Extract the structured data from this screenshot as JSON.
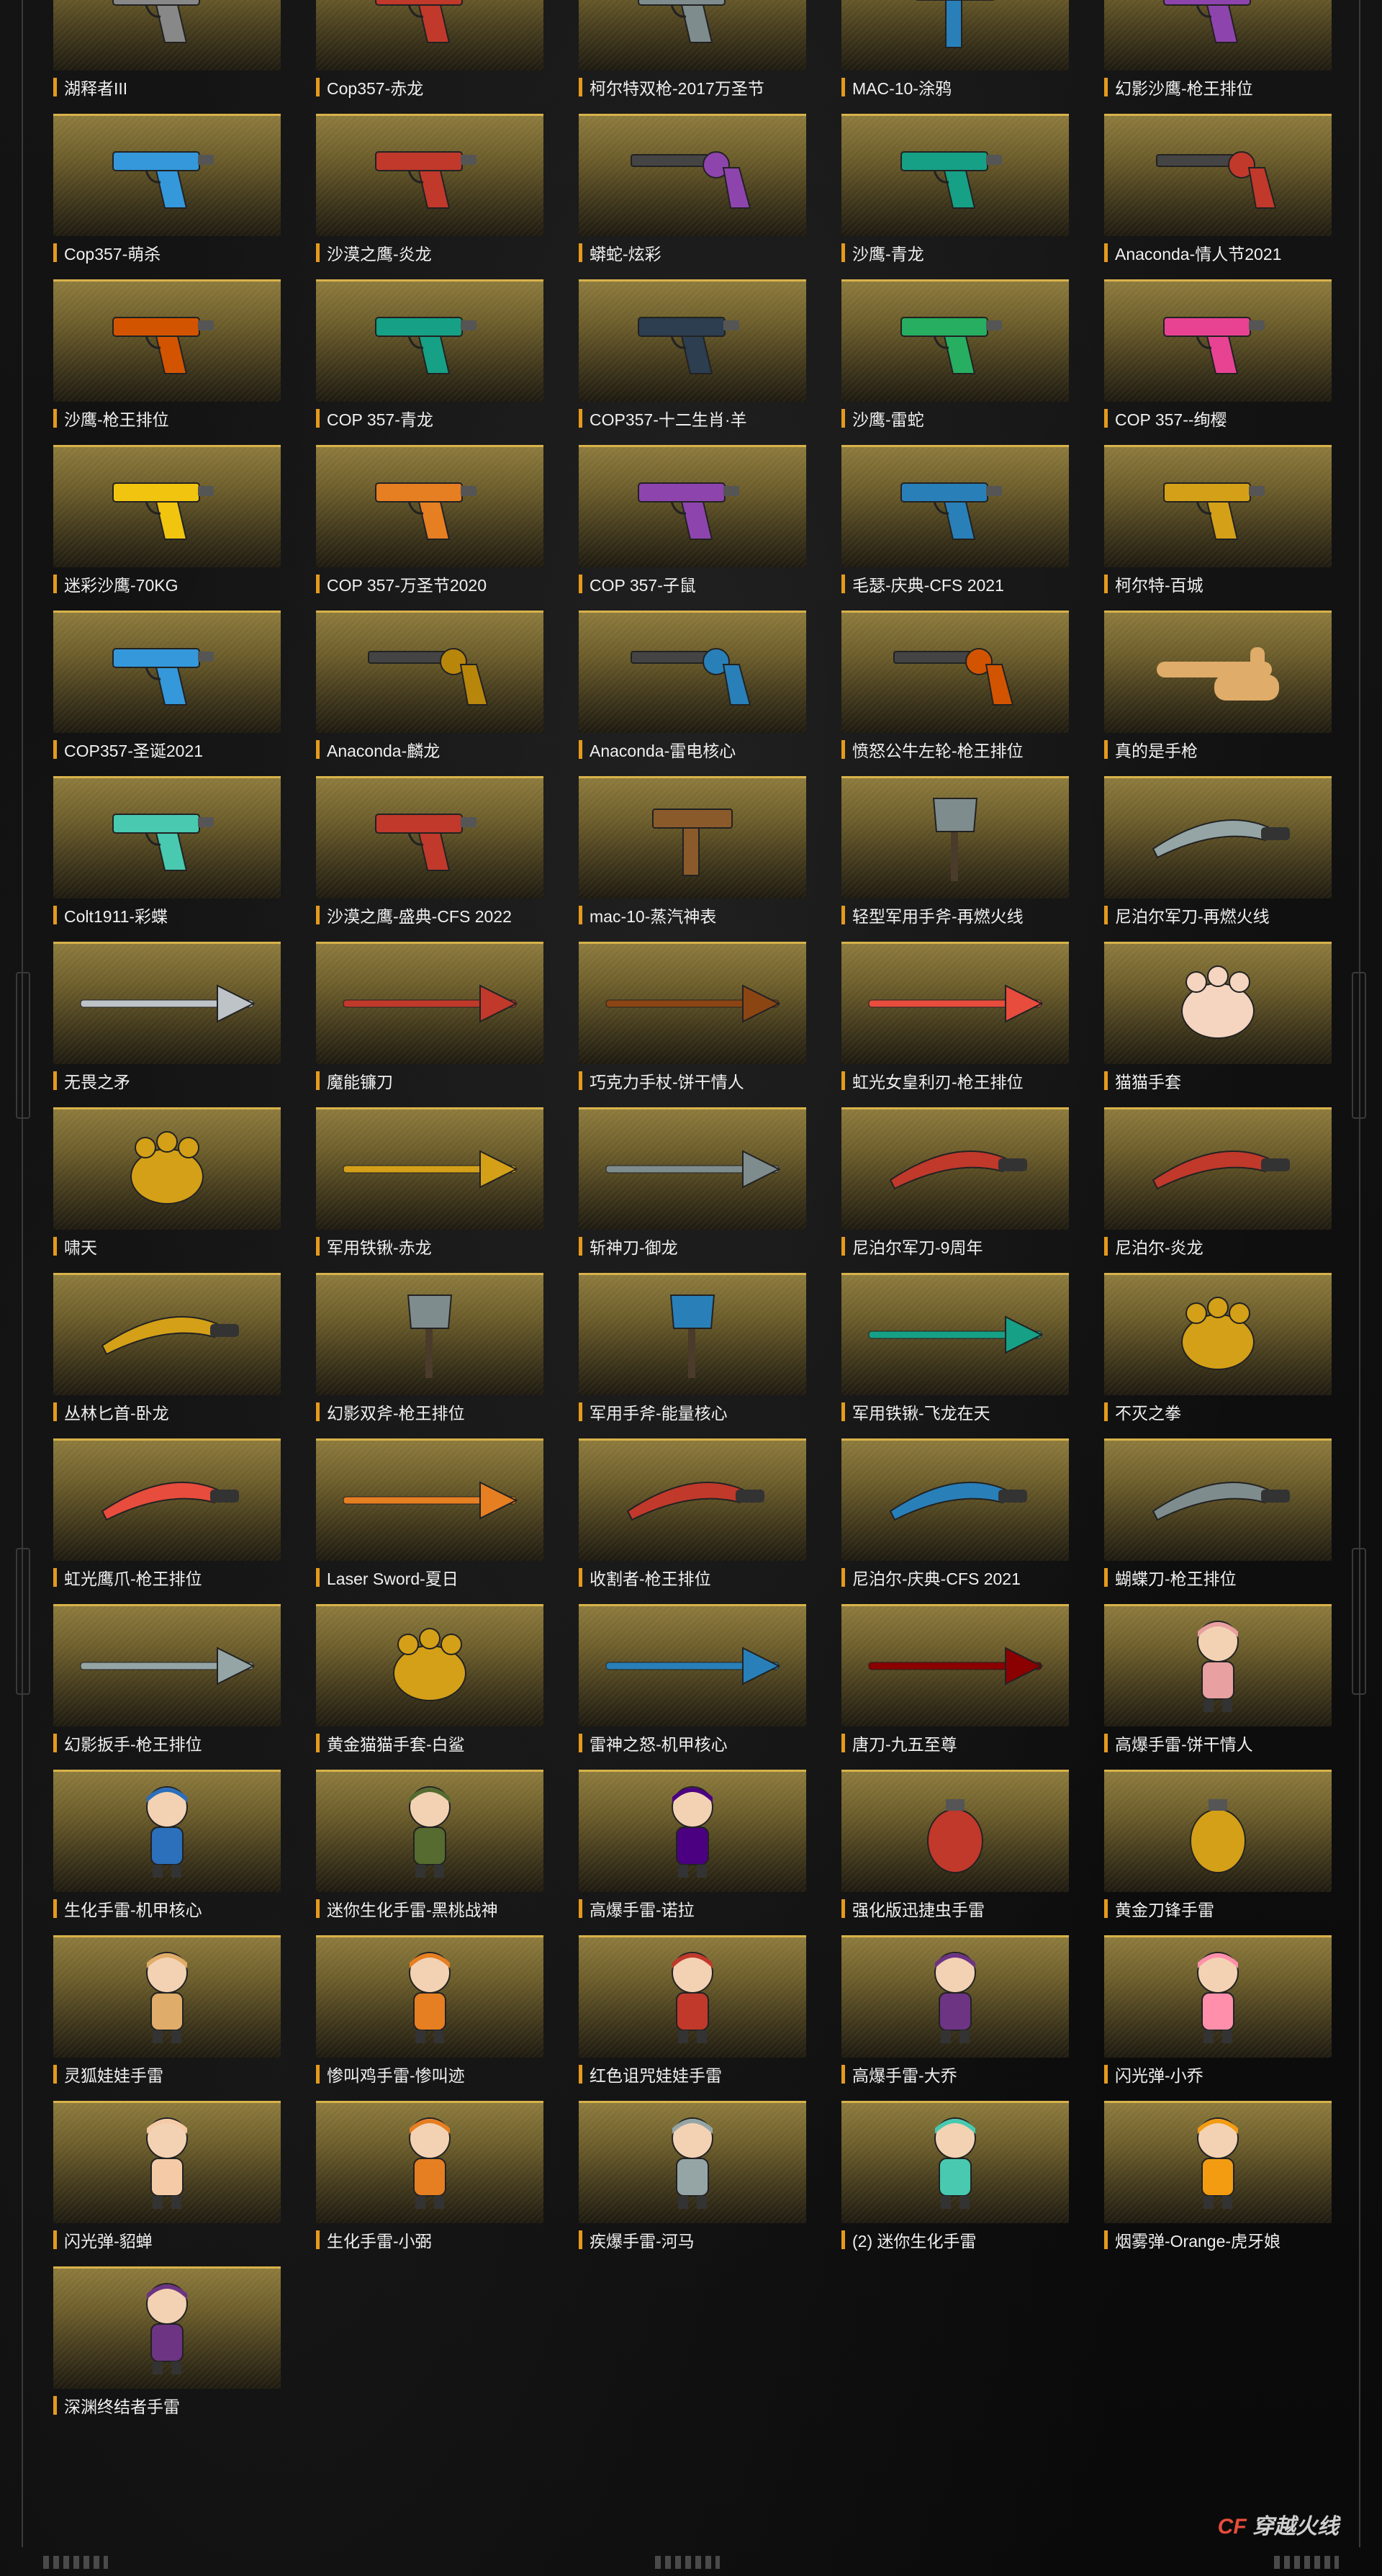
{
  "items": [
    {
      "label": "湖释者III",
      "icon": "gun-icon",
      "color": "#888888"
    },
    {
      "label": "Cop357-赤龙",
      "icon": "pistol-icon",
      "color": "#c0392b"
    },
    {
      "label": "柯尔特双枪-2017万圣节",
      "icon": "pistol-icon",
      "color": "#7f8c8d"
    },
    {
      "label": "MAC-10-涂鸦",
      "icon": "smg-icon",
      "color": "#2980b9"
    },
    {
      "label": "幻影沙鹰-枪王排位",
      "icon": "pistol-icon",
      "color": "#8e44ad"
    },
    {
      "label": "Cop357-萌杀",
      "icon": "pistol-icon",
      "color": "#3498db"
    },
    {
      "label": "沙漠之鹰-炎龙",
      "icon": "pistol-icon",
      "color": "#c0392b"
    },
    {
      "label": "蟒蛇-炫彩",
      "icon": "revolver-icon",
      "color": "#8e44ad"
    },
    {
      "label": "沙鹰-青龙",
      "icon": "pistol-icon",
      "color": "#16a085"
    },
    {
      "label": "Anaconda-情人节2021",
      "icon": "revolver-icon",
      "color": "#c0392b"
    },
    {
      "label": "沙鹰-枪王排位",
      "icon": "pistol-icon",
      "color": "#d35400"
    },
    {
      "label": "COP 357-青龙",
      "icon": "pistol-icon",
      "color": "#16a085"
    },
    {
      "label": "COP357-十二生肖·羊",
      "icon": "pistol-icon",
      "color": "#2c3e50"
    },
    {
      "label": "沙鹰-雷蛇",
      "icon": "pistol-icon",
      "color": "#27ae60"
    },
    {
      "label": "COP 357--绚樱",
      "icon": "pistol-icon",
      "color": "#e84393"
    },
    {
      "label": "迷彩沙鹰-70KG",
      "icon": "pistol-icon",
      "color": "#f1c40f"
    },
    {
      "label": "COP 357-万圣节2020",
      "icon": "pistol-icon",
      "color": "#e67e22"
    },
    {
      "label": "COP 357-子鼠",
      "icon": "pistol-icon",
      "color": "#8e44ad"
    },
    {
      "label": "毛瑟-庆典-CFS 2021",
      "icon": "pistol-icon",
      "color": "#2980b9"
    },
    {
      "label": "柯尔特-百城",
      "icon": "pistol-icon",
      "color": "#d4a017"
    },
    {
      "label": "COP357-圣诞2021",
      "icon": "pistol-icon",
      "color": "#3498db"
    },
    {
      "label": "Anaconda-麟龙",
      "icon": "revolver-icon",
      "color": "#b8860b"
    },
    {
      "label": "Anaconda-雷电核心",
      "icon": "revolver-icon",
      "color": "#2980b9"
    },
    {
      "label": "愤怒公牛左轮-枪王排位",
      "icon": "revolver-icon",
      "color": "#d35400"
    },
    {
      "label": "真的是手枪",
      "icon": "hand-icon",
      "color": "#e0ac69"
    },
    {
      "label": "Colt1911-彩蝶",
      "icon": "pistol-icon",
      "color": "#48c9b0"
    },
    {
      "label": "沙漠之鹰-盛典-CFS 2022",
      "icon": "pistol-icon",
      "color": "#c0392b"
    },
    {
      "label": "mac-10-蒸汽神表",
      "icon": "smg-icon",
      "color": "#8b5a2b"
    },
    {
      "label": "轻型军用手斧-再燃火线",
      "icon": "axe-icon",
      "color": "#7f8c8d"
    },
    {
      "label": "尼泊尔军刀-再燃火线",
      "icon": "knife-icon",
      "color": "#95a5a6"
    },
    {
      "label": "无畏之矛",
      "icon": "spear-icon",
      "color": "#bdc3c7"
    },
    {
      "label": "魔能镰刀",
      "icon": "scythe-icon",
      "color": "#c0392b"
    },
    {
      "label": "巧克力手杖-饼干情人",
      "icon": "staff-icon",
      "color": "#8b4513"
    },
    {
      "label": "虹光女皇利刃-枪王排位",
      "icon": "blade-icon",
      "color": "#e74c3c"
    },
    {
      "label": "猫猫手套",
      "icon": "paw-icon",
      "color": "#f5d5c0"
    },
    {
      "label": "啸天",
      "icon": "claw-icon",
      "color": "#d4a017"
    },
    {
      "label": "军用铁锹-赤龙",
      "icon": "shovel-icon",
      "color": "#d4a017"
    },
    {
      "label": "斩神刀-御龙",
      "icon": "sword-icon",
      "color": "#7f8c8d"
    },
    {
      "label": "尼泊尔军刀-9周年",
      "icon": "knife-icon",
      "color": "#c0392b"
    },
    {
      "label": "尼泊尔-炎龙",
      "icon": "knife-icon",
      "color": "#c0392b"
    },
    {
      "label": "丛林匕首-卧龙",
      "icon": "dagger-icon",
      "color": "#d4a017"
    },
    {
      "label": "幻影双斧-枪王排位",
      "icon": "axe-icon",
      "color": "#7f8c8d"
    },
    {
      "label": "军用手斧-能量核心",
      "icon": "axe-icon",
      "color": "#2980b9"
    },
    {
      "label": "军用铁锹-飞龙在天",
      "icon": "shovel-icon",
      "color": "#16a085"
    },
    {
      "label": "不灭之拳",
      "icon": "fist-icon",
      "color": "#d4a017"
    },
    {
      "label": "虹光鹰爪-枪王排位",
      "icon": "karambit-icon",
      "color": "#e74c3c"
    },
    {
      "label": "Laser Sword-夏日",
      "icon": "laser-sword-icon",
      "color": "#e67e22"
    },
    {
      "label": "收割者-枪王排位",
      "icon": "knife-icon",
      "color": "#c0392b"
    },
    {
      "label": "尼泊尔-庆典-CFS 2021",
      "icon": "knife-icon",
      "color": "#2980b9"
    },
    {
      "label": "蝴蝶刀-枪王排位",
      "icon": "butterfly-knife-icon",
      "color": "#7f8c8d"
    },
    {
      "label": "幻影扳手-枪王排位",
      "icon": "wrench-icon",
      "color": "#95a5a6"
    },
    {
      "label": "黄金猫猫手套-白鲨",
      "icon": "shark-glove-icon",
      "color": "#d4a017"
    },
    {
      "label": "雷神之怒-机甲核心",
      "icon": "hammer-icon",
      "color": "#2980b9"
    },
    {
      "label": "唐刀-九五至尊",
      "icon": "katana-icon",
      "color": "#8b0000"
    },
    {
      "label": "高爆手雷-饼干情人",
      "icon": "grenade-doll-icon",
      "color": "#e8a0a0"
    },
    {
      "label": "生化手雷-机甲核心",
      "icon": "grenade-doll-icon",
      "color": "#2c6fbb"
    },
    {
      "label": "迷你生化手雷-黑桃战神",
      "icon": "grenade-doll-icon",
      "color": "#556b2f"
    },
    {
      "label": "高爆手雷-诺拉",
      "icon": "grenade-doll-icon",
      "color": "#4b0082"
    },
    {
      "label": "强化版迅捷虫手雷",
      "icon": "grenade-bug-icon",
      "color": "#c0392b"
    },
    {
      "label": "黄金刀锋手雷",
      "icon": "grenade-icon",
      "color": "#d4a017"
    },
    {
      "label": "灵狐娃娃手雷",
      "icon": "grenade-doll-icon",
      "color": "#e0ac69"
    },
    {
      "label": "惨叫鸡手雷-惨叫迹",
      "icon": "grenade-doll-icon",
      "color": "#e67e22"
    },
    {
      "label": "红色诅咒娃娃手雷",
      "icon": "grenade-doll-icon",
      "color": "#c0392b"
    },
    {
      "label": "高爆手雷-大乔",
      "icon": "grenade-doll-icon",
      "color": "#6c3483"
    },
    {
      "label": "闪光弹-小乔",
      "icon": "grenade-doll-icon",
      "color": "#ff8fab"
    },
    {
      "label": "闪光弹-貂蝉",
      "icon": "grenade-doll-icon",
      "color": "#f5cba7"
    },
    {
      "label": "生化手雷-小弼",
      "icon": "grenade-doll-icon",
      "color": "#e67e22"
    },
    {
      "label": "疾爆手雷-河马",
      "icon": "grenade-doll-icon",
      "color": "#95a5a6"
    },
    {
      "label": "(2) 迷你生化手雷",
      "icon": "grenade-doll-icon",
      "color": "#48c9b0"
    },
    {
      "label": "烟雾弹-Orange-虎牙娘",
      "icon": "grenade-doll-icon",
      "color": "#f39c12"
    },
    {
      "label": "深渊终结者手雷",
      "icon": "grenade-doll-icon",
      "color": "#6c3483"
    }
  ],
  "logo": {
    "text": "穿越火线",
    "icon": "cf-logo-icon"
  }
}
